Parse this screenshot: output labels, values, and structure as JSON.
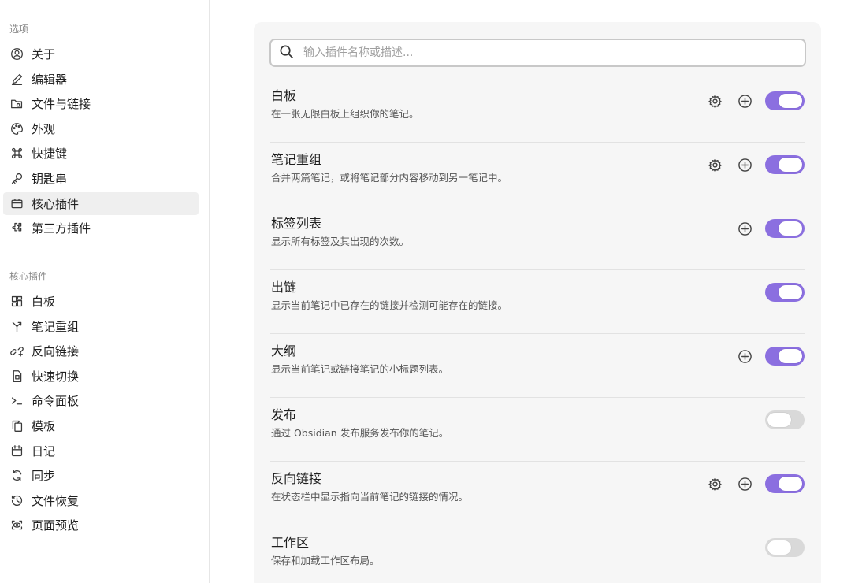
{
  "sidebar": {
    "options_title": "选项",
    "options_items": [
      {
        "label": "关于",
        "icon": "user-circle-icon"
      },
      {
        "label": "编辑器",
        "icon": "pen-icon"
      },
      {
        "label": "文件与链接",
        "icon": "folder-search-icon"
      },
      {
        "label": "外观",
        "icon": "palette-icon"
      },
      {
        "label": "快捷键",
        "icon": "command-icon"
      },
      {
        "label": "钥匙串",
        "icon": "key-icon"
      },
      {
        "label": "核心插件",
        "icon": "briefcase-icon",
        "active": true
      },
      {
        "label": "第三方插件",
        "icon": "puzzle-icon"
      }
    ],
    "core_title": "核心插件",
    "core_items": [
      {
        "label": "白板",
        "icon": "layout-dashboard-icon"
      },
      {
        "label": "笔记重组",
        "icon": "merge-icon"
      },
      {
        "label": "反向链接",
        "icon": "link-back-icon"
      },
      {
        "label": "快速切换",
        "icon": "file-switch-icon"
      },
      {
        "label": "命令面板",
        "icon": "terminal-icon"
      },
      {
        "label": "模板",
        "icon": "copy-icon"
      },
      {
        "label": "日记",
        "icon": "calendar-icon"
      },
      {
        "label": "同步",
        "icon": "sync-icon"
      },
      {
        "label": "文件恢复",
        "icon": "history-icon"
      },
      {
        "label": "页面预览",
        "icon": "eye-scan-icon"
      }
    ]
  },
  "search": {
    "placeholder": "输入插件名称或描述...",
    "value": ""
  },
  "plugins": [
    {
      "name": "白板",
      "desc": "在一张无限白板上组织你的笔记。",
      "settings": true,
      "hotkey": true,
      "enabled": true
    },
    {
      "name": "笔记重组",
      "desc": "合并两篇笔记，或将笔记部分内容移动到另一笔记中。",
      "settings": true,
      "hotkey": true,
      "enabled": true
    },
    {
      "name": "标签列表",
      "desc": "显示所有标签及其出现的次数。",
      "settings": false,
      "hotkey": true,
      "enabled": true
    },
    {
      "name": "出链",
      "desc": "显示当前笔记中已存在的链接并检测可能存在的链接。",
      "settings": false,
      "hotkey": false,
      "enabled": true
    },
    {
      "name": "大纲",
      "desc": "显示当前笔记或链接笔记的小标题列表。",
      "settings": false,
      "hotkey": true,
      "enabled": true
    },
    {
      "name": "发布",
      "desc": "通过 Obsidian 发布服务发布你的笔记。",
      "settings": false,
      "hotkey": false,
      "enabled": false
    },
    {
      "name": "反向链接",
      "desc": "在状态栏中显示指向当前笔记的链接的情况。",
      "settings": true,
      "hotkey": true,
      "enabled": true
    },
    {
      "name": "工作区",
      "desc": "保存和加载工作区布局。",
      "settings": false,
      "hotkey": false,
      "enabled": false
    }
  ],
  "colors": {
    "accent": "#8b6fe0",
    "toggle_off": "#d9d9d9",
    "active_bg": "#efefef"
  }
}
